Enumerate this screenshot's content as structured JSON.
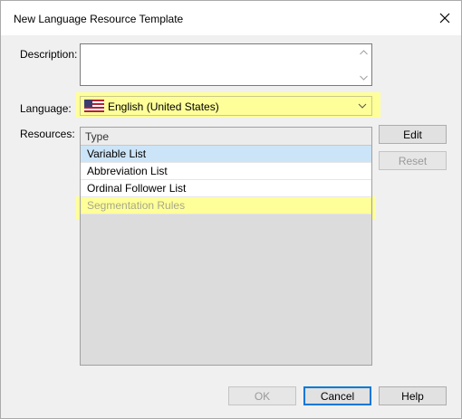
{
  "dialog": {
    "title": "New Language Resource Template"
  },
  "description": {
    "label": "Description:",
    "value": ""
  },
  "language": {
    "label": "Language:",
    "selected": "English (United States)",
    "flag_icon": "us-flag-icon",
    "highlight_color": "#ffff99"
  },
  "resources": {
    "label": "Resources:",
    "column_header": "Type",
    "items": [
      {
        "label": "Variable List",
        "state": "selected"
      },
      {
        "label": "Abbreviation List",
        "state": "normal"
      },
      {
        "label": "Ordinal Follower List",
        "state": "normal"
      },
      {
        "label": "Segmentation Rules",
        "state": "highlighted"
      }
    ]
  },
  "side_buttons": {
    "edit": "Edit",
    "reset": "Reset"
  },
  "footer": {
    "ok": "OK",
    "cancel": "Cancel",
    "help": "Help"
  },
  "colors": {
    "selection": "#cce4f7",
    "highlight": "#ffff99",
    "default_button_border": "#0078d7"
  }
}
